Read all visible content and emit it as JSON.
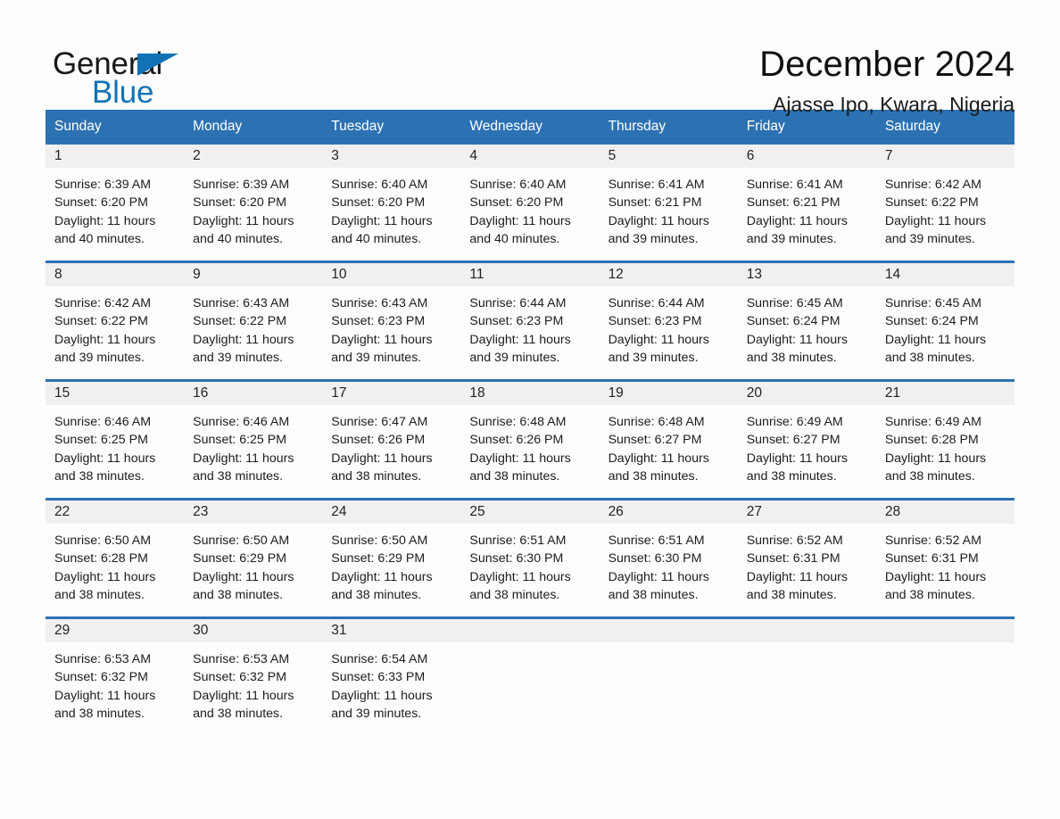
{
  "brand": {
    "name_part1": "General",
    "name_part2": "Blue",
    "accent_color": "#1272b6"
  },
  "header": {
    "title": "December 2024",
    "location": "Ajasse Ipo, Kwara, Nigeria"
  },
  "theme": {
    "header_blue": "#2c72b3",
    "daynum_gray": "#f0f0f0",
    "page_bg": "#fdfdfd"
  },
  "weekday_headers": [
    "Sunday",
    "Monday",
    "Tuesday",
    "Wednesday",
    "Thursday",
    "Friday",
    "Saturday"
  ],
  "weeks": [
    [
      {
        "day": "1",
        "sunrise": "Sunrise: 6:39 AM",
        "sunset": "Sunset: 6:20 PM",
        "daylight1": "Daylight: 11 hours",
        "daylight2": "and 40 minutes."
      },
      {
        "day": "2",
        "sunrise": "Sunrise: 6:39 AM",
        "sunset": "Sunset: 6:20 PM",
        "daylight1": "Daylight: 11 hours",
        "daylight2": "and 40 minutes."
      },
      {
        "day": "3",
        "sunrise": "Sunrise: 6:40 AM",
        "sunset": "Sunset: 6:20 PM",
        "daylight1": "Daylight: 11 hours",
        "daylight2": "and 40 minutes."
      },
      {
        "day": "4",
        "sunrise": "Sunrise: 6:40 AM",
        "sunset": "Sunset: 6:20 PM",
        "daylight1": "Daylight: 11 hours",
        "daylight2": "and 40 minutes."
      },
      {
        "day": "5",
        "sunrise": "Sunrise: 6:41 AM",
        "sunset": "Sunset: 6:21 PM",
        "daylight1": "Daylight: 11 hours",
        "daylight2": "and 39 minutes."
      },
      {
        "day": "6",
        "sunrise": "Sunrise: 6:41 AM",
        "sunset": "Sunset: 6:21 PM",
        "daylight1": "Daylight: 11 hours",
        "daylight2": "and 39 minutes."
      },
      {
        "day": "7",
        "sunrise": "Sunrise: 6:42 AM",
        "sunset": "Sunset: 6:22 PM",
        "daylight1": "Daylight: 11 hours",
        "daylight2": "and 39 minutes."
      }
    ],
    [
      {
        "day": "8",
        "sunrise": "Sunrise: 6:42 AM",
        "sunset": "Sunset: 6:22 PM",
        "daylight1": "Daylight: 11 hours",
        "daylight2": "and 39 minutes."
      },
      {
        "day": "9",
        "sunrise": "Sunrise: 6:43 AM",
        "sunset": "Sunset: 6:22 PM",
        "daylight1": "Daylight: 11 hours",
        "daylight2": "and 39 minutes."
      },
      {
        "day": "10",
        "sunrise": "Sunrise: 6:43 AM",
        "sunset": "Sunset: 6:23 PM",
        "daylight1": "Daylight: 11 hours",
        "daylight2": "and 39 minutes."
      },
      {
        "day": "11",
        "sunrise": "Sunrise: 6:44 AM",
        "sunset": "Sunset: 6:23 PM",
        "daylight1": "Daylight: 11 hours",
        "daylight2": "and 39 minutes."
      },
      {
        "day": "12",
        "sunrise": "Sunrise: 6:44 AM",
        "sunset": "Sunset: 6:23 PM",
        "daylight1": "Daylight: 11 hours",
        "daylight2": "and 39 minutes."
      },
      {
        "day": "13",
        "sunrise": "Sunrise: 6:45 AM",
        "sunset": "Sunset: 6:24 PM",
        "daylight1": "Daylight: 11 hours",
        "daylight2": "and 38 minutes."
      },
      {
        "day": "14",
        "sunrise": "Sunrise: 6:45 AM",
        "sunset": "Sunset: 6:24 PM",
        "daylight1": "Daylight: 11 hours",
        "daylight2": "and 38 minutes."
      }
    ],
    [
      {
        "day": "15",
        "sunrise": "Sunrise: 6:46 AM",
        "sunset": "Sunset: 6:25 PM",
        "daylight1": "Daylight: 11 hours",
        "daylight2": "and 38 minutes."
      },
      {
        "day": "16",
        "sunrise": "Sunrise: 6:46 AM",
        "sunset": "Sunset: 6:25 PM",
        "daylight1": "Daylight: 11 hours",
        "daylight2": "and 38 minutes."
      },
      {
        "day": "17",
        "sunrise": "Sunrise: 6:47 AM",
        "sunset": "Sunset: 6:26 PM",
        "daylight1": "Daylight: 11 hours",
        "daylight2": "and 38 minutes."
      },
      {
        "day": "18",
        "sunrise": "Sunrise: 6:48 AM",
        "sunset": "Sunset: 6:26 PM",
        "daylight1": "Daylight: 11 hours",
        "daylight2": "and 38 minutes."
      },
      {
        "day": "19",
        "sunrise": "Sunrise: 6:48 AM",
        "sunset": "Sunset: 6:27 PM",
        "daylight1": "Daylight: 11 hours",
        "daylight2": "and 38 minutes."
      },
      {
        "day": "20",
        "sunrise": "Sunrise: 6:49 AM",
        "sunset": "Sunset: 6:27 PM",
        "daylight1": "Daylight: 11 hours",
        "daylight2": "and 38 minutes."
      },
      {
        "day": "21",
        "sunrise": "Sunrise: 6:49 AM",
        "sunset": "Sunset: 6:28 PM",
        "daylight1": "Daylight: 11 hours",
        "daylight2": "and 38 minutes."
      }
    ],
    [
      {
        "day": "22",
        "sunrise": "Sunrise: 6:50 AM",
        "sunset": "Sunset: 6:28 PM",
        "daylight1": "Daylight: 11 hours",
        "daylight2": "and 38 minutes."
      },
      {
        "day": "23",
        "sunrise": "Sunrise: 6:50 AM",
        "sunset": "Sunset: 6:29 PM",
        "daylight1": "Daylight: 11 hours",
        "daylight2": "and 38 minutes."
      },
      {
        "day": "24",
        "sunrise": "Sunrise: 6:50 AM",
        "sunset": "Sunset: 6:29 PM",
        "daylight1": "Daylight: 11 hours",
        "daylight2": "and 38 minutes."
      },
      {
        "day": "25",
        "sunrise": "Sunrise: 6:51 AM",
        "sunset": "Sunset: 6:30 PM",
        "daylight1": "Daylight: 11 hours",
        "daylight2": "and 38 minutes."
      },
      {
        "day": "26",
        "sunrise": "Sunrise: 6:51 AM",
        "sunset": "Sunset: 6:30 PM",
        "daylight1": "Daylight: 11 hours",
        "daylight2": "and 38 minutes."
      },
      {
        "day": "27",
        "sunrise": "Sunrise: 6:52 AM",
        "sunset": "Sunset: 6:31 PM",
        "daylight1": "Daylight: 11 hours",
        "daylight2": "and 38 minutes."
      },
      {
        "day": "28",
        "sunrise": "Sunrise: 6:52 AM",
        "sunset": "Sunset: 6:31 PM",
        "daylight1": "Daylight: 11 hours",
        "daylight2": "and 38 minutes."
      }
    ],
    [
      {
        "day": "29",
        "sunrise": "Sunrise: 6:53 AM",
        "sunset": "Sunset: 6:32 PM",
        "daylight1": "Daylight: 11 hours",
        "daylight2": "and 38 minutes."
      },
      {
        "day": "30",
        "sunrise": "Sunrise: 6:53 AM",
        "sunset": "Sunset: 6:32 PM",
        "daylight1": "Daylight: 11 hours",
        "daylight2": "and 38 minutes."
      },
      {
        "day": "31",
        "sunrise": "Sunrise: 6:54 AM",
        "sunset": "Sunset: 6:33 PM",
        "daylight1": "Daylight: 11 hours",
        "daylight2": "and 39 minutes."
      },
      {
        "day": "",
        "sunrise": "",
        "sunset": "",
        "daylight1": "",
        "daylight2": ""
      },
      {
        "day": "",
        "sunrise": "",
        "sunset": "",
        "daylight1": "",
        "daylight2": ""
      },
      {
        "day": "",
        "sunrise": "",
        "sunset": "",
        "daylight1": "",
        "daylight2": ""
      },
      {
        "day": "",
        "sunrise": "",
        "sunset": "",
        "daylight1": "",
        "daylight2": ""
      }
    ]
  ]
}
